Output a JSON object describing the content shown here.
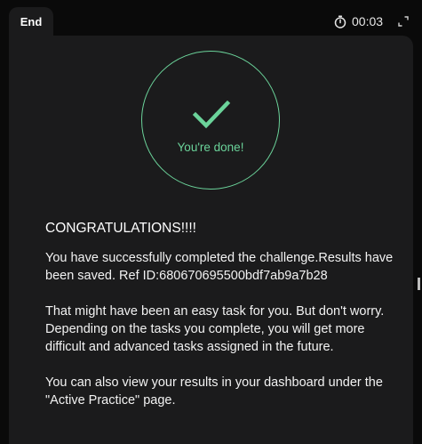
{
  "header": {
    "tab_label": "End",
    "timer": "00:03",
    "timer_icon": "stopwatch-icon",
    "expand_icon": "expand-icon"
  },
  "result": {
    "status_icon": "check-icon",
    "status_text": "You're done!",
    "accent_color": "#6bd39a"
  },
  "message": {
    "heading": "CONGRATULATIONS!!!!",
    "paragraph1": "You have successfully completed the challenge.Results have been saved. Ref ID:680670695500bdf7ab9a7b28",
    "paragraph2": "That might have been an easy task for you. But don't worry. Depending on the tasks you complete, you will get more difficult and advanced tasks assigned in the future.",
    "paragraph3": "You can also view your results in your dashboard under the \"Active Practice\" page."
  }
}
